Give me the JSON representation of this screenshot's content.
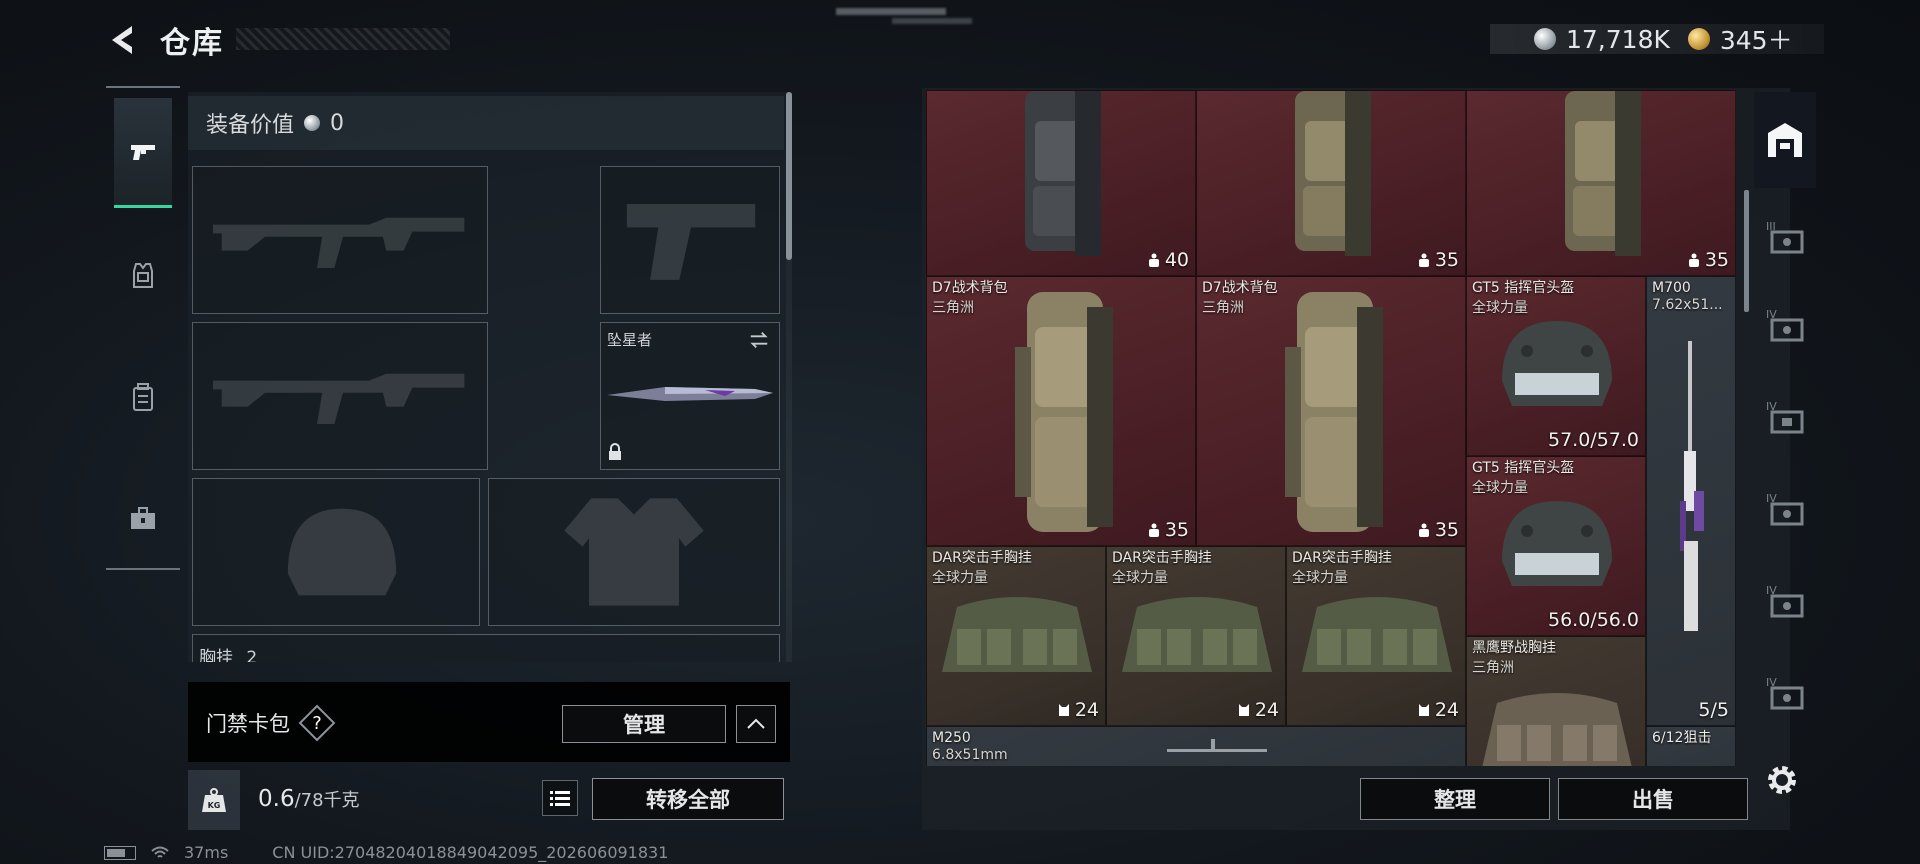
{
  "header": {
    "title": "仓库",
    "back_icon": "back-arrow-icon",
    "currency": [
      {
        "icon": "silver-coin-icon",
        "value": "17,718K"
      },
      {
        "icon": "gold-coin-icon",
        "value": "345＋"
      }
    ]
  },
  "categories": [
    {
      "name": "weapons",
      "icon": "pistol-icon",
      "active": true
    },
    {
      "name": "armor",
      "icon": "armor-vest-icon",
      "active": false
    },
    {
      "name": "backpack",
      "icon": "backpack-icon",
      "active": false
    },
    {
      "name": "supplies",
      "icon": "toolbox-icon",
      "active": false
    }
  ],
  "equipment": {
    "value_label": "装备价值",
    "value": "0",
    "melee_name": "坠星者",
    "chest_label": "胸挂",
    "chest_count": "2"
  },
  "keycard": {
    "label": "门禁卡包",
    "help": "?",
    "manage_label": "管理"
  },
  "footer_left": {
    "weight_current": "0.6",
    "weight_max": "/78千克",
    "transfer_all_label": "转移全部"
  },
  "status": {
    "ping": "37ms",
    "uid": "CN UID:27048204018849042095_202606091831"
  },
  "warehouse": {
    "items": [
      {
        "type": "backpack",
        "name": "",
        "sub": "",
        "count": "40",
        "bg": "red",
        "count_icon": "capacity-icon"
      },
      {
        "type": "backpack",
        "name": "",
        "sub": "",
        "count": "35",
        "bg": "red",
        "count_icon": "capacity-icon"
      },
      {
        "type": "backpack",
        "name": "",
        "sub": "",
        "count": "35",
        "bg": "red",
        "count_icon": "capacity-icon"
      },
      {
        "type": "backpack",
        "name": "D7战术背包",
        "sub": "三角洲",
        "count": "35",
        "bg": "red",
        "count_icon": "capacity-icon"
      },
      {
        "type": "backpack",
        "name": "D7战术背包",
        "sub": "三角洲",
        "count": "35",
        "bg": "red",
        "count_icon": "capacity-icon"
      },
      {
        "type": "helmet",
        "name": "GT5 指挥官头盔",
        "sub": "全球力量",
        "count": "57.0/57.0",
        "bg": "red"
      },
      {
        "type": "helmet",
        "name": "GT5 指挥官头盔",
        "sub": "全球力量",
        "count": "56.0/56.0",
        "bg": "red"
      },
      {
        "type": "rifle",
        "name": "M700",
        "sub": "7.62x51...",
        "count": "5/5",
        "bg": "grey"
      },
      {
        "type": "rig",
        "name": "DAR突击手胸挂",
        "sub": "全球力量",
        "count": "24",
        "bg": "brown",
        "count_icon": "rig-capacity-icon"
      },
      {
        "type": "rig",
        "name": "DAR突击手胸挂",
        "sub": "全球力量",
        "count": "24",
        "bg": "brown",
        "count_icon": "rig-capacity-icon"
      },
      {
        "type": "rig",
        "name": "DAR突击手胸挂",
        "sub": "全球力量",
        "count": "24",
        "bg": "brown",
        "count_icon": "rig-capacity-icon"
      },
      {
        "type": "rig",
        "name": "黑鹰野战胸挂",
        "sub": "三角洲",
        "count": "",
        "bg": "brown"
      },
      {
        "type": "ammo",
        "name": "M250",
        "sub": "6.8x51mm",
        "count": "",
        "bg": "grey"
      },
      {
        "type": "ammo",
        "name": "6/12狙击",
        "sub": "",
        "count": "",
        "bg": "grey"
      }
    ]
  },
  "storage_tabs": [
    {
      "icon": "storage-main-icon",
      "level": ""
    },
    {
      "icon": "storage-expansion-icon",
      "level": "III"
    },
    {
      "icon": "storage-expansion-icon",
      "level": "IV"
    },
    {
      "icon": "storage-expansion-icon",
      "level": "IV"
    },
    {
      "icon": "storage-expansion-icon",
      "level": "IV"
    },
    {
      "icon": "storage-expansion-icon",
      "level": "IV"
    },
    {
      "icon": "storage-expansion-icon",
      "level": "IV"
    }
  ],
  "actions": {
    "sort_label": "整理",
    "sell_label": "出售",
    "settings_icon": "gear-icon"
  },
  "colors": {
    "accent_green": "#37d7a0",
    "cell_red": "#4a1f25",
    "cell_brown": "#383029",
    "cell_grey": "#2b3137"
  }
}
